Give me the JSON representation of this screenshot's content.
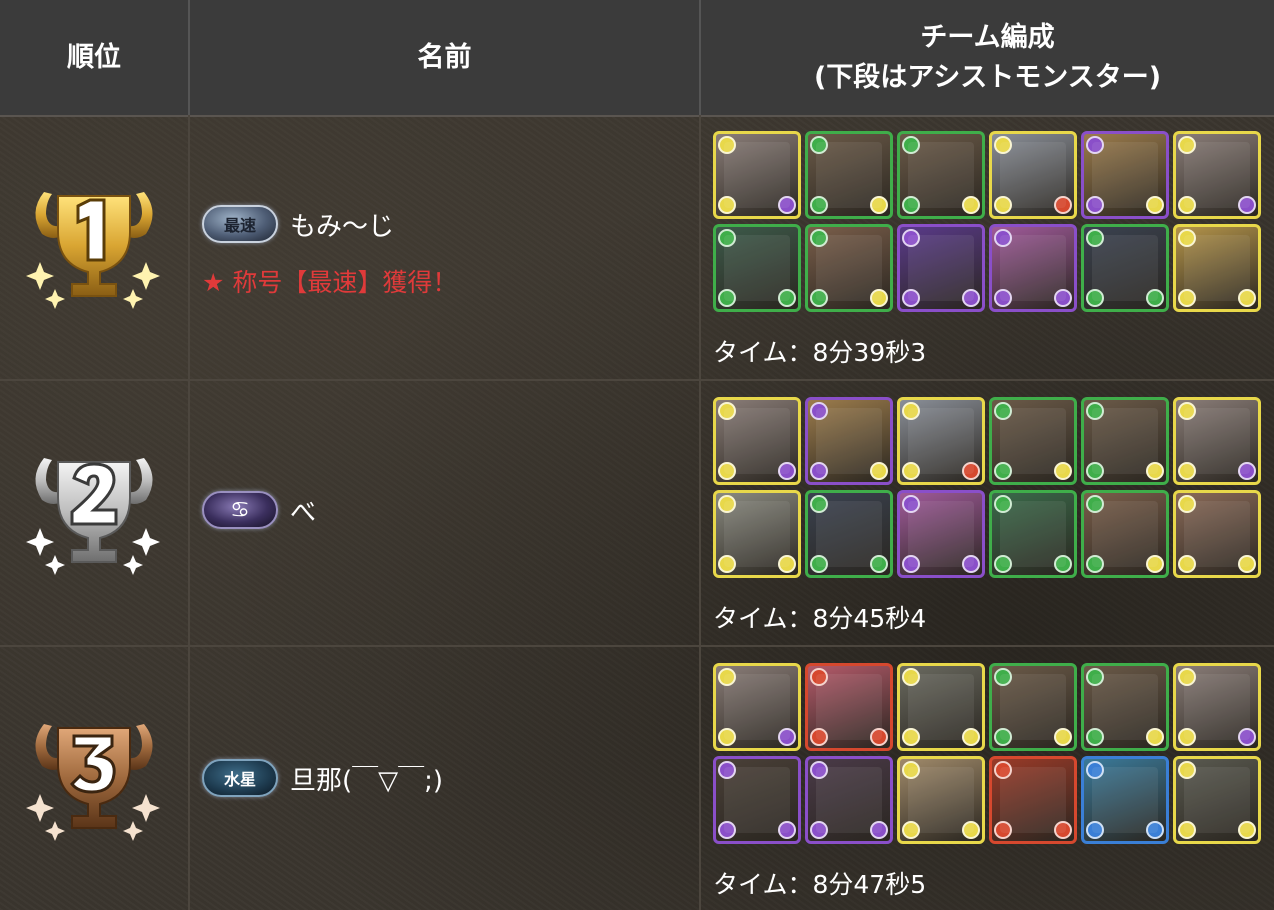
{
  "header": {
    "rank_label": "順位",
    "name_label": "名前",
    "team_label_line1": "チーム編成",
    "team_label_line2": "(下段はアシストモンスター)"
  },
  "colors": {
    "gold": "#d9a532",
    "silver": "#bdbdbd",
    "bronze": "#a06a3e",
    "title_red": "#e03a3a",
    "attr_light": "#e8d84a",
    "attr_dark": "#8a4fc9",
    "attr_wood": "#3fae4a",
    "attr_fire": "#d6482e",
    "attr_water": "#3a7fd6"
  },
  "rankings": [
    {
      "rank": "1",
      "badge_text": "最速",
      "player_name": "もみ〜じ",
      "title_gain": "★ 称号【最速】獲得！",
      "time": "タイム：8分39秒3",
      "team": [
        {
          "attr": "light",
          "sub": "dark",
          "fill": "#8a7d78"
        },
        {
          "attr": "wood",
          "sub": "light",
          "fill": "#6b5a48"
        },
        {
          "attr": "wood",
          "sub": "light",
          "fill": "#6b5a48"
        },
        {
          "attr": "light",
          "sub": "fire",
          "fill": "#8a8f98"
        },
        {
          "attr": "dark",
          "sub": "light",
          "fill": "#9c7c4c"
        },
        {
          "attr": "light",
          "sub": "dark",
          "fill": "#8a7d78"
        }
      ],
      "assists": [
        {
          "attr": "wood",
          "sub": "wood",
          "fill": "#3d5a4a"
        },
        {
          "attr": "wood",
          "sub": "light",
          "fill": "#7a5e4a"
        },
        {
          "attr": "dark",
          "sub": "dark",
          "fill": "#5a3a8a"
        },
        {
          "attr": "dark",
          "sub": "dark",
          "fill": "#a05a9a"
        },
        {
          "attr": "wood",
          "sub": "wood",
          "fill": "#3a4250"
        },
        {
          "attr": "light",
          "sub": "light",
          "fill": "#b4944a"
        }
      ]
    },
    {
      "rank": "2",
      "badge_text": "♋",
      "player_name": "べ",
      "title_gain": "",
      "time": "タイム：8分45秒4",
      "team": [
        {
          "attr": "light",
          "sub": "dark",
          "fill": "#8a7d78"
        },
        {
          "attr": "dark",
          "sub": "light",
          "fill": "#9c7c4c"
        },
        {
          "attr": "light",
          "sub": "fire",
          "fill": "#8a8f98"
        },
        {
          "attr": "wood",
          "sub": "light",
          "fill": "#6b5a48"
        },
        {
          "attr": "wood",
          "sub": "light",
          "fill": "#6b5a48"
        },
        {
          "attr": "light",
          "sub": "dark",
          "fill": "#8a7d78"
        }
      ],
      "assists": [
        {
          "attr": "light",
          "sub": "light",
          "fill": "#8a8a80"
        },
        {
          "attr": "wood",
          "sub": "wood",
          "fill": "#3a4250"
        },
        {
          "attr": "dark",
          "sub": "dark",
          "fill": "#a05a9a"
        },
        {
          "attr": "wood",
          "sub": "wood",
          "fill": "#3a6a4a"
        },
        {
          "attr": "wood",
          "sub": "light",
          "fill": "#7a5e4a"
        },
        {
          "attr": "light",
          "sub": "light",
          "fill": "#8a6a58"
        }
      ]
    },
    {
      "rank": "3",
      "badge_text": "水星",
      "player_name": "旦那(￣▽￣;)",
      "title_gain": "",
      "time": "タイム：8分47秒5",
      "team": [
        {
          "attr": "light",
          "sub": "dark",
          "fill": "#8a7d78"
        },
        {
          "attr": "fire",
          "sub": "fire",
          "fill": "#b45a6a"
        },
        {
          "attr": "light",
          "sub": "light",
          "fill": "#6a6a60"
        },
        {
          "attr": "wood",
          "sub": "light",
          "fill": "#6b5a48"
        },
        {
          "attr": "wood",
          "sub": "light",
          "fill": "#6b5a48"
        },
        {
          "attr": "light",
          "sub": "dark",
          "fill": "#8a7d78"
        }
      ],
      "assists": [
        {
          "attr": "dark",
          "sub": "dark",
          "fill": "#4a4038"
        },
        {
          "attr": "dark",
          "sub": "dark",
          "fill": "#4a3a48"
        },
        {
          "attr": "light",
          "sub": "light",
          "fill": "#a08a6a"
        },
        {
          "attr": "fire",
          "sub": "fire",
          "fill": "#9a3a28"
        },
        {
          "attr": "water",
          "sub": "water",
          "fill": "#3a7a9a"
        },
        {
          "attr": "light",
          "sub": "light",
          "fill": "#5a5a50"
        }
      ]
    }
  ]
}
